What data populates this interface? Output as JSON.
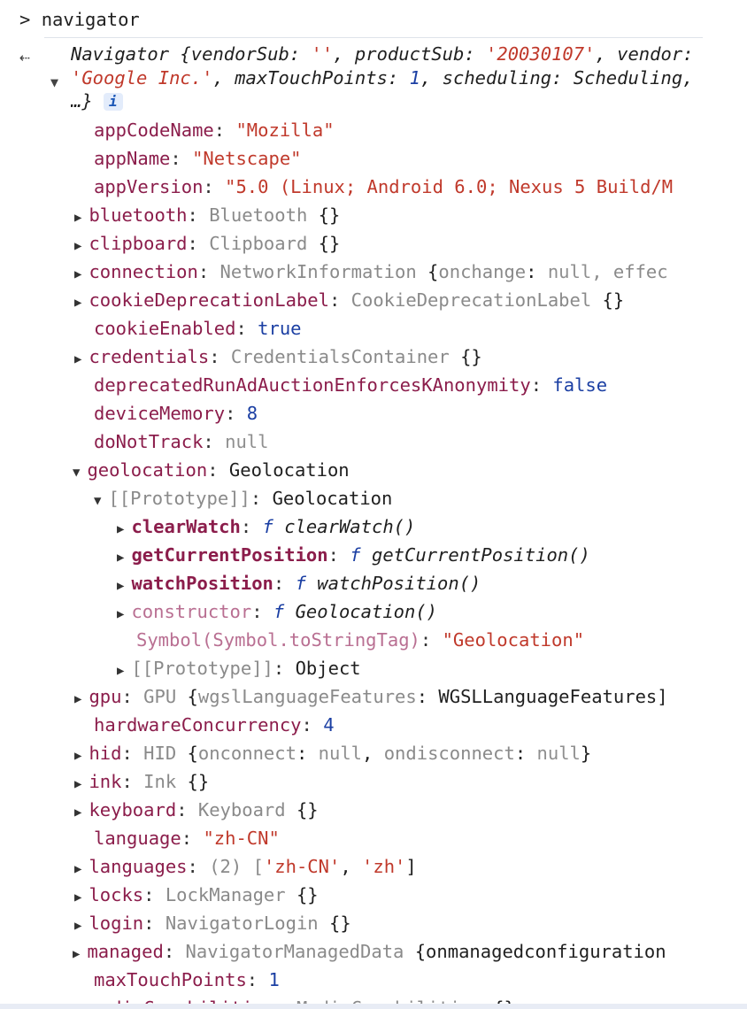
{
  "console": {
    "prompt_symbol": ">",
    "command": "navigator",
    "return_symbol": "⇠",
    "summary": {
      "prefix": "Navigator {vendorSub: ",
      "vendorSub": "''",
      "mid1": ", productSub: ",
      "productSub": "'20030107'",
      "mid2": ", vendor: ",
      "vendor": "'Google Inc.'",
      "mid3": ", maxTouchPoints: ",
      "maxTouchPoints": "1",
      "mid4": ", scheduling: Scheduling, …}",
      "info_badge": "i"
    },
    "rows": [
      {
        "key": "appCodeName",
        "val": "\"Mozilla\""
      },
      {
        "key": "appName",
        "val": "\"Netscape\""
      },
      {
        "key": "appVersion",
        "val": "\"5.0 (Linux; Android 6.0; Nexus 5 Build/M"
      },
      {
        "key": "bluetooth",
        "val": "Bluetooth {}"
      },
      {
        "key": "clipboard",
        "val": "Clipboard {}"
      },
      {
        "key": "connection",
        "val_cls": "NetworkInformation",
        "val_brace": " {",
        "val_k": "onchange",
        "val_sep": ": ",
        "val_nul": "null",
        "val_rest": ", effec"
      },
      {
        "key": "cookieDeprecationLabel",
        "val_cls": "CookieDeprecationLabel",
        "val_rest": " {}"
      },
      {
        "key": "cookieEnabled",
        "val": "true"
      },
      {
        "key": "credentials",
        "val_cls": "CredentialsContainer",
        "val_rest": " {}"
      },
      {
        "key": "deprecatedRunAdAuctionEnforcesKAnonymity",
        "val": "false"
      },
      {
        "key": "deviceMemory",
        "val": "8"
      },
      {
        "key": "doNotTrack",
        "val": "null"
      },
      {
        "key": "geolocation",
        "val": "Geolocation"
      },
      {
        "key": "[[Prototype]]",
        "val": "Geolocation"
      },
      {
        "key": "clearWatch",
        "fsym": "f",
        "val": "clearWatch()"
      },
      {
        "key": "getCurrentPosition",
        "fsym": "f",
        "val": "getCurrentPosition()"
      },
      {
        "key": "watchPosition",
        "fsym": "f",
        "val": "watchPosition()"
      },
      {
        "key": "constructor",
        "fsym": "f",
        "val": "Geolocation()"
      },
      {
        "key": "Symbol(Symbol.toStringTag)",
        "val": "\"Geolocation\""
      },
      {
        "key": "[[Prototype]]",
        "val": "Object"
      },
      {
        "key": "gpu",
        "val_cls": "GPU",
        "val_brace": " {",
        "val_k": "wgslLanguageFeatures",
        "val_sep": ": ",
        "val_rest": "WGSLLanguageFeatures]"
      },
      {
        "key": "hardwareConcurrency",
        "val": "4"
      },
      {
        "key": "hid",
        "val_cls": "HID",
        "val_brace": " {",
        "val_k": "onconnect",
        "val_sep": ": ",
        "val_nul": "null",
        "val_mid": ", ",
        "val_k2": "ondisconnect",
        "val_sep2": ": ",
        "val_nul2": "null",
        "val_rest": "}"
      },
      {
        "key": "ink",
        "val_cls": "Ink",
        "val_rest": " {}"
      },
      {
        "key": "keyboard",
        "val_cls": "Keyboard",
        "val_rest": " {}"
      },
      {
        "key": "language",
        "val": "\"zh-CN\""
      },
      {
        "key": "languages",
        "val_pre": "(2) [",
        "val_s1": "'zh-CN'",
        "val_mid": ", ",
        "val_s2": "'zh'",
        "val_rest": "]"
      },
      {
        "key": "locks",
        "val_cls": "LockManager",
        "val_rest": " {}"
      },
      {
        "key": "login",
        "val_cls": "NavigatorLogin",
        "val_rest": " {}"
      },
      {
        "key": "managed",
        "val_cls": "NavigatorManagedData",
        "val_rest": " {onmanagedconfiguration"
      },
      {
        "key": "maxTouchPoints",
        "val": "1"
      },
      {
        "key": "mediaCapabilities",
        "val_cls": "MediaCapabilities",
        "val_rest": " {}"
      }
    ]
  }
}
